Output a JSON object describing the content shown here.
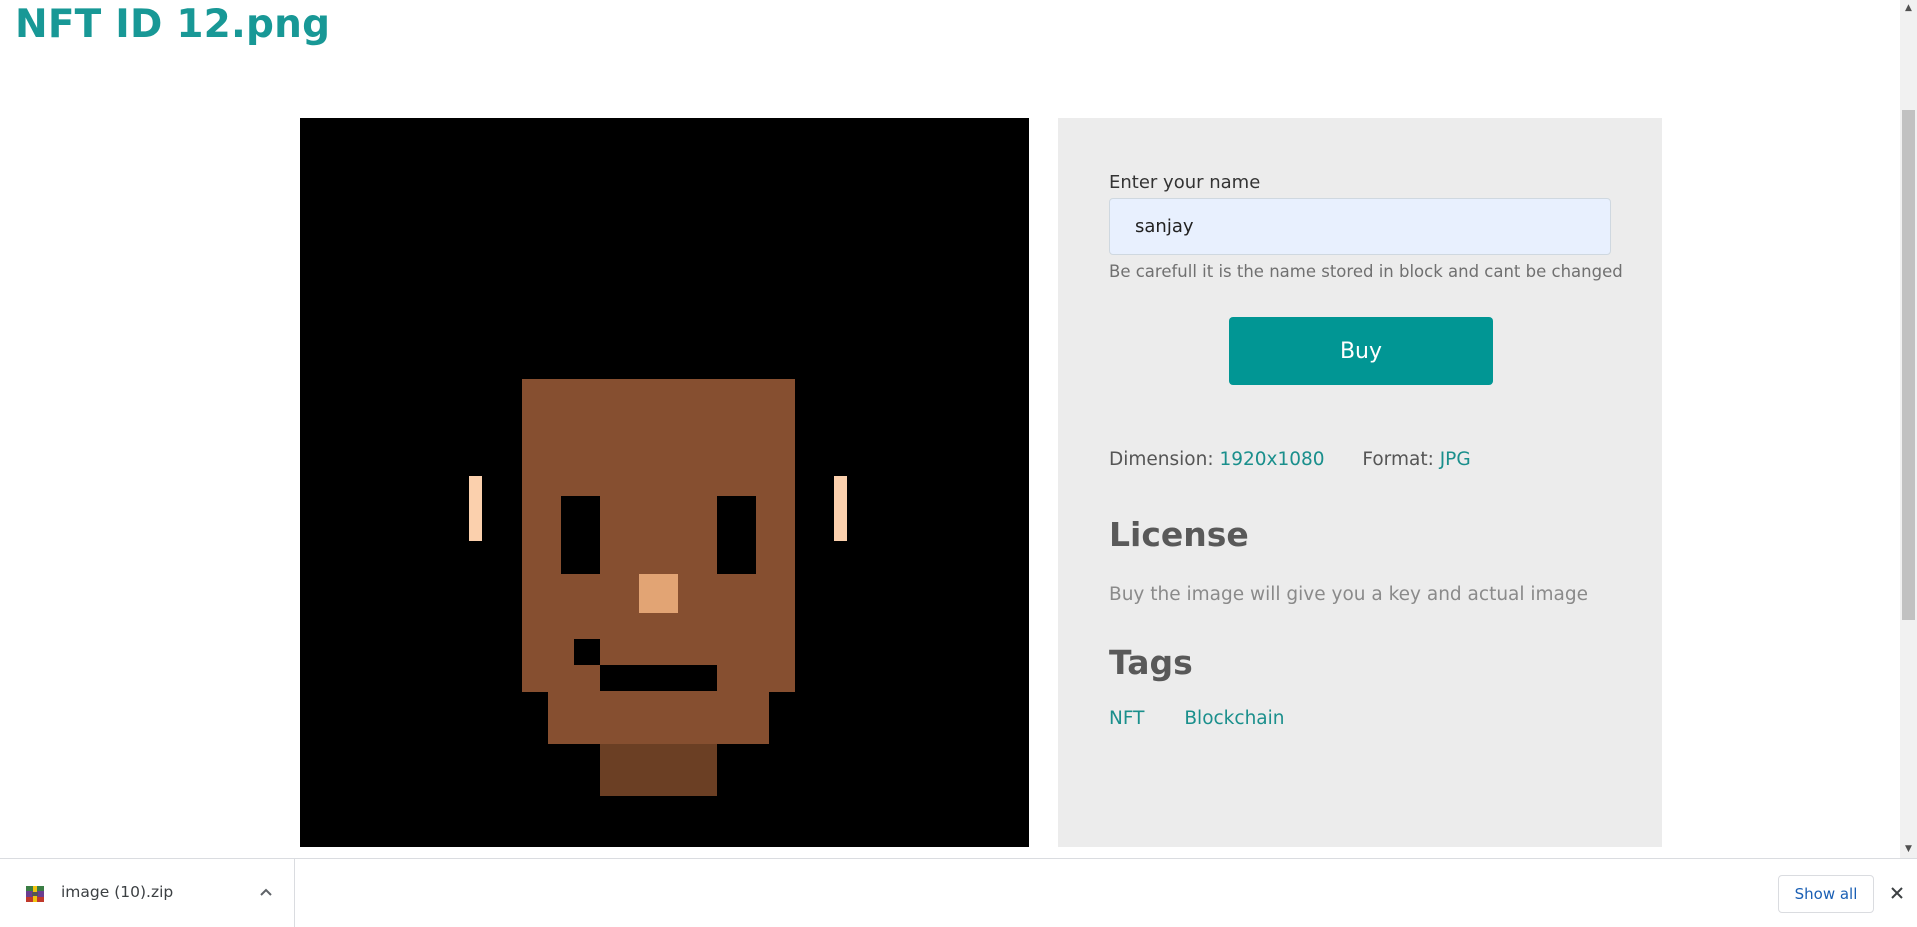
{
  "page": {
    "title": "NFT ID 12.png"
  },
  "nft_image": {
    "description_icon": "pixel-face-icon"
  },
  "form": {
    "name_label": "Enter your name",
    "name_value": "sanjay",
    "help_text": "Be carefull it is the name stored in block and cant be changed",
    "buy_label": "Buy"
  },
  "specs": {
    "dimension_label": "Dimension:",
    "dimension_value": "1920x1080",
    "format_label": "Format:",
    "format_value": "JPG"
  },
  "license": {
    "heading": "License",
    "text": "Buy the image will give you a key and actual image"
  },
  "tags": {
    "heading": "Tags",
    "items": [
      "NFT",
      "Blockchain"
    ]
  },
  "download_bar": {
    "file_name": "image (10).zip",
    "file_icon": "archive-icon",
    "show_all_label": "Show all",
    "close_icon": "close-icon",
    "chevron_icon": "chevron-up-icon"
  },
  "colors": {
    "accent": "#189896",
    "button": "#019694",
    "panel_bg": "#ececec",
    "face_skin": "#864f30",
    "neck": "#6b3f24",
    "nose": "#e2a474",
    "earrings": "#fbd0ad"
  }
}
